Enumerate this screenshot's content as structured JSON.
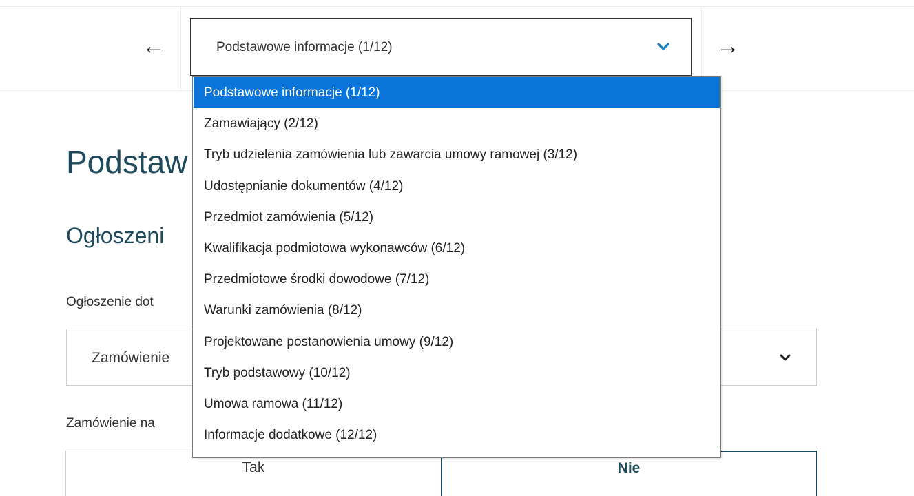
{
  "nav": {
    "prev_icon": "←",
    "next_icon": "→",
    "selected_section": "Podstawowe informacje (1/12)",
    "sections": [
      "Podstawowe informacje (1/12)",
      "Zamawiający (2/12)",
      "Tryb udzielenia zamówienia lub zawarcia umowy ramowej (3/12)",
      "Udostępnianie dokumentów (4/12)",
      "Przedmiot zamówienia (5/12)",
      "Kwalifikacja podmiotowa wykonawców (6/12)",
      "Przedmiotowe środki dowodowe (7/12)",
      "Warunki zamówienia (8/12)",
      "Projektowane postanowienia umowy (9/12)",
      "Tryb podstawowy (10/12)",
      "Umowa ramowa (11/12)",
      "Informacje dodatkowe (12/12)"
    ],
    "selected_index": 0
  },
  "content": {
    "heading": "Podstaw",
    "subheading": "Ogłoszeni",
    "field1_label": "Ogłoszenie dot",
    "field1_value": "Zamówienie",
    "field2_label": "Zamówienie na",
    "toggle_yes": "Tak",
    "toggle_no": "Nie"
  },
  "colors": {
    "accent_blue": "#0a74da",
    "heading_teal": "#1f4a5c",
    "chevron_blue": "#1a7fc1"
  },
  "icons": {
    "nav_chevron": "chevron-down-icon",
    "field_chevron": "chevron-down-icon"
  }
}
